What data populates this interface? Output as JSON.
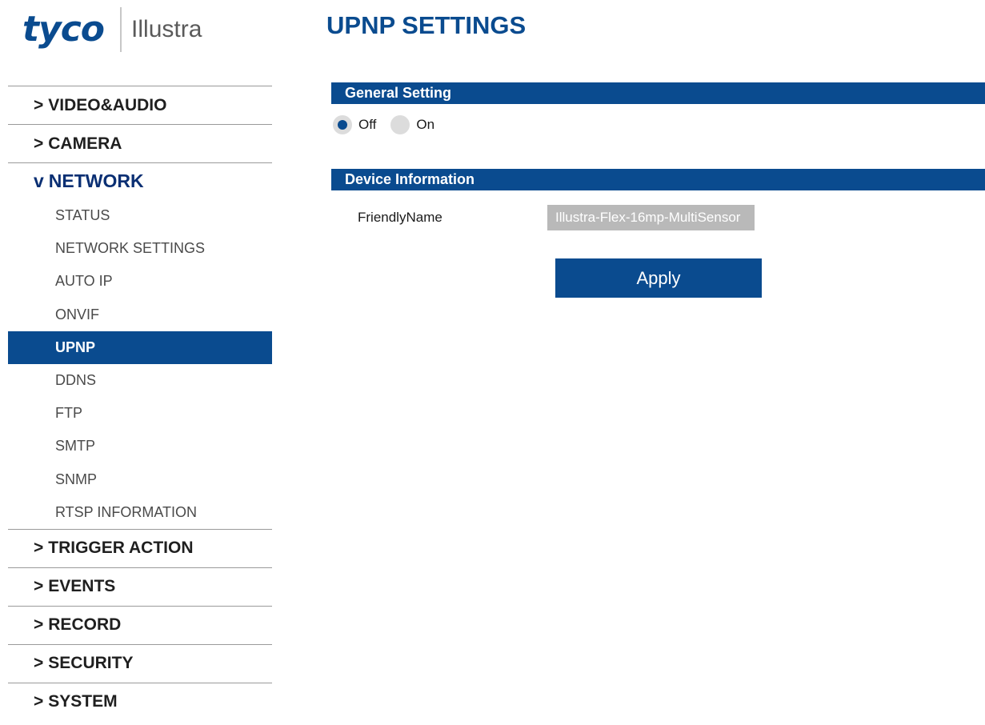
{
  "logo": {
    "brand": "tyco",
    "product": "Illustra"
  },
  "sidebar": {
    "sections_before": [
      {
        "arrow": ">",
        "label": "VIDEO&AUDIO"
      },
      {
        "arrow": ">",
        "label": "CAMERA"
      }
    ],
    "open_section": {
      "arrow": "v",
      "label": "NETWORK"
    },
    "sub_items": [
      {
        "label": "STATUS"
      },
      {
        "label": "NETWORK SETTINGS"
      },
      {
        "label": "AUTO IP"
      },
      {
        "label": "ONVIF"
      },
      {
        "label": "UPNP",
        "active": true
      },
      {
        "label": "DDNS"
      },
      {
        "label": "FTP"
      },
      {
        "label": "SMTP"
      },
      {
        "label": "SNMP"
      },
      {
        "label": "RTSP INFORMATION"
      }
    ],
    "sections_after": [
      {
        "arrow": ">",
        "label": "TRIGGER ACTION"
      },
      {
        "arrow": ">",
        "label": "EVENTS"
      },
      {
        "arrow": ">",
        "label": "RECORD"
      },
      {
        "arrow": ">",
        "label": "SECURITY"
      },
      {
        "arrow": ">",
        "label": "SYSTEM"
      }
    ]
  },
  "main": {
    "title": "UPNP SETTINGS",
    "general": {
      "header": "General Setting",
      "options": [
        {
          "label": "Off",
          "checked": true
        },
        {
          "label": "On",
          "checked": false
        }
      ]
    },
    "device": {
      "header": "Device Information",
      "friendly_name_label": "FriendlyName",
      "friendly_name_value": "Illustra-Flex-16mp-MultiSensor"
    },
    "apply_label": "Apply"
  },
  "colors": {
    "brand": "#0a4b8f",
    "active_nav": "#0a4b8f",
    "input_bg": "#b9b9b9"
  }
}
